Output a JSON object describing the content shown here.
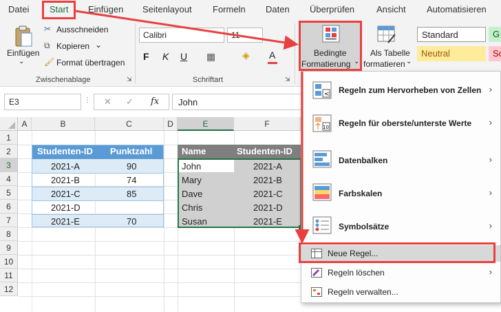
{
  "tabs": [
    "Datei",
    "Start",
    "Einfügen",
    "Seitenlayout",
    "Formeln",
    "Daten",
    "Überprüfen",
    "Ansicht",
    "Automatisieren"
  ],
  "clipboard": {
    "paste_label": "Einfügen",
    "cut_label": "Ausschneiden",
    "copy_label": "Kopieren",
    "format_painter_label": "Format übertragen",
    "group_label": "Zwischenablage"
  },
  "font": {
    "font_name": "Calibri",
    "font_size": "11",
    "bold": "F",
    "italic": "K",
    "underline": "U",
    "font_color_letter": "A",
    "group_label": "Schriftart"
  },
  "styles": {
    "conditional_formatting_line1": "Bedingte",
    "conditional_formatting_line2": "Formatierung",
    "format_as_table_line1": "Als Tabelle",
    "format_as_table_line2": "formatieren",
    "style_standard": "Standard",
    "style_neutral": "Neutral",
    "style_g": "G",
    "style_sc": "Sc"
  },
  "formula_bar": {
    "name_box": "E3",
    "fx": "fx",
    "value": "John"
  },
  "grid": {
    "columns": [
      "A",
      "B",
      "C",
      "D",
      "E",
      "F"
    ],
    "rows": [
      "1",
      "2",
      "3",
      "4",
      "5",
      "6",
      "7",
      "8",
      "9",
      "10",
      "11",
      "12"
    ],
    "table1_headers": [
      "Studenten-ID",
      "Punktzahl"
    ],
    "table1_rows": [
      [
        "2021-A",
        "90"
      ],
      [
        "2021-B",
        "74"
      ],
      [
        "2021-C",
        "85"
      ],
      [
        "2021-D",
        ""
      ],
      [
        "2021-E",
        "70"
      ]
    ],
    "table2_headers": [
      "Name",
      "Studenten-ID"
    ],
    "table2_rows": [
      [
        "John",
        "2021-A"
      ],
      [
        "Mary",
        "2021-B"
      ],
      [
        "Dave",
        "2021-C"
      ],
      [
        "Chris",
        "2021-D"
      ],
      [
        "Susan",
        "2021-E"
      ]
    ]
  },
  "menu": {
    "items": [
      "Regeln zum Hervorheben von Zellen",
      "Regeln für oberste/unterste Werte",
      "Datenbalken",
      "Farbskalen",
      "Symbolsätze",
      "Neue Regel...",
      "Regeln löschen",
      "Regeln verwalten..."
    ]
  },
  "colors": {
    "excel_green": "#217346",
    "annotation_red": "#e8403f",
    "table_header_blue": "#5b9bd5",
    "table_band_blue": "#ddebf7",
    "table2_header_gray": "#7f7f7f",
    "table2_band_gray": "#d0d0d0"
  }
}
